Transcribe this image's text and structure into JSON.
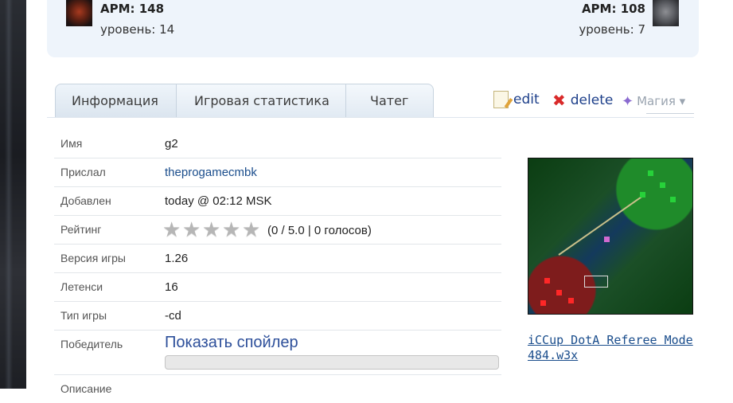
{
  "players": {
    "left": {
      "apm": "APM: 148",
      "level": "уровень: 14"
    },
    "right": {
      "apm": "APM: 108",
      "level": "уровень: 7"
    }
  },
  "tabs": [
    {
      "label": "Информация"
    },
    {
      "label": "Игровая статистика"
    },
    {
      "label": "Чатег"
    }
  ],
  "actions": {
    "edit": "edit",
    "delete": "delete",
    "magic": "Магия ▾"
  },
  "details": {
    "name": {
      "label": "Имя",
      "value": "g2"
    },
    "uploader": {
      "label": "Прислал",
      "value": "theprogamecmbk"
    },
    "added": {
      "label": "Добавлен",
      "value": "today @ 02:12 MSK"
    },
    "rating": {
      "label": "Рейтинг",
      "value": "(0 / 5.0 | 0 голосов)",
      "stars": 0,
      "max_stars": 5
    },
    "version": {
      "label": "Версия игры",
      "value": "1.26"
    },
    "latency": {
      "label": "Летенси",
      "value": "16"
    },
    "game_type": {
      "label": "Тип игры",
      "value": "-cd"
    },
    "winner": {
      "label": "Победитель",
      "spoiler": "Показать спойлер"
    },
    "description": {
      "label": "Описание"
    }
  },
  "map": {
    "caption": "iCCup DotA Referee Mode 484.w3x"
  },
  "colors": {
    "link": "#1a4d8c",
    "spoiler": "#2d4f9a",
    "delete": "#d92a2a",
    "panel": "#eef4fb"
  }
}
